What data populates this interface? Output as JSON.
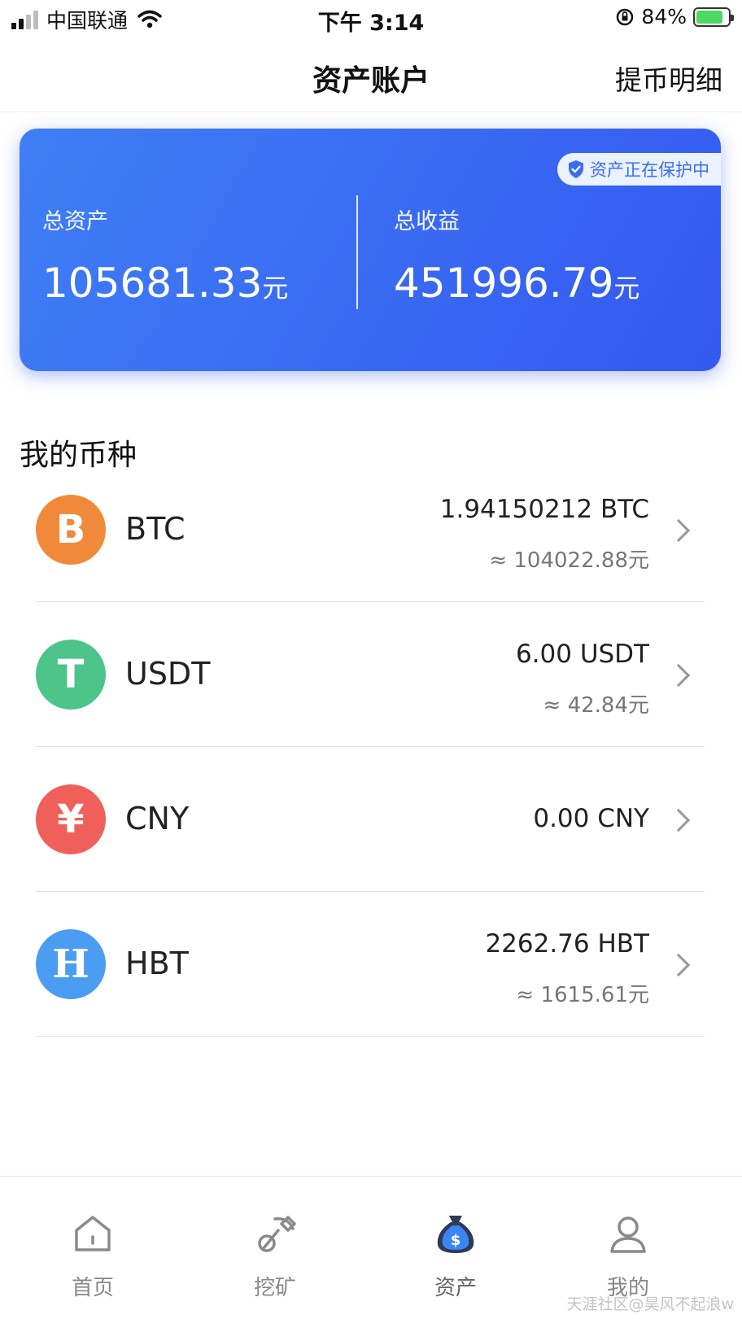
{
  "status_bar": {
    "carrier": "中国联通",
    "time": "下午 3:14",
    "battery": "84%",
    "battery_level": 0.84
  },
  "nav": {
    "title": "资产账户",
    "right_link": "提币明细"
  },
  "card": {
    "badge": "资产正在保护中",
    "total_assets_label": "总资产",
    "total_assets_value": "105681.33",
    "total_assets_unit": "元",
    "total_income_label": "总收益",
    "total_income_value": "451996.79",
    "total_income_unit": "元",
    "colors": {
      "card_start": "#3f7ff5",
      "card_end": "#3458f0"
    }
  },
  "section": {
    "title": "我的币种"
  },
  "coins": [
    {
      "name": "BTC",
      "amount": "1.94150212 BTC",
      "cny": "≈ 104022.88元",
      "icon": "bitcoin-icon",
      "glyph": "B",
      "color": "#f08a3a"
    },
    {
      "name": "USDT",
      "amount": "6.00 USDT",
      "cny": "≈ 42.84元",
      "icon": "tether-icon",
      "glyph": "T",
      "color": "#4cc48a"
    },
    {
      "name": "CNY",
      "amount": "0.00 CNY",
      "cny": "",
      "icon": "yuan-icon",
      "glyph": "¥",
      "color": "#f0605a"
    },
    {
      "name": "HBT",
      "amount": "2262.76 HBT",
      "cny": "≈ 1615.61元",
      "icon": "hbt-icon",
      "glyph": "H",
      "color": "#4a9df0"
    }
  ],
  "tabs": [
    {
      "label": "首页",
      "icon": "home-icon",
      "active": false
    },
    {
      "label": "挖矿",
      "icon": "mining-icon",
      "active": false
    },
    {
      "label": "资产",
      "icon": "money-bag-icon",
      "active": true
    },
    {
      "label": "我的",
      "icon": "user-icon",
      "active": false
    }
  ],
  "watermark": "天涯社区@昊风不起浪w"
}
